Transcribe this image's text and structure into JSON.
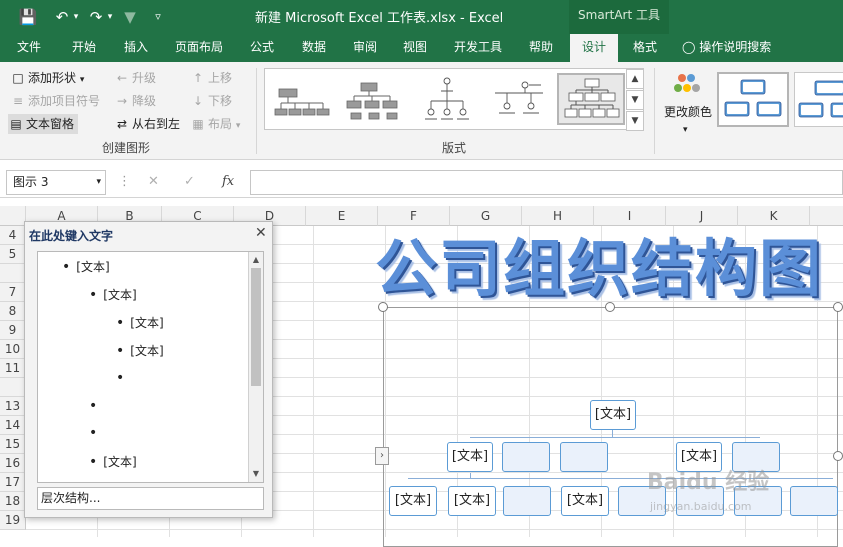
{
  "window": {
    "title": "新建 Microsoft Excel 工作表.xlsx  -  Excel",
    "context_title": "SmartArt 工具",
    "save_icon": "save-icon",
    "undo_icon": "undo-icon",
    "redo_icon": "redo-icon",
    "filter_icon": "filter-icon",
    "customize_icon": "customize-qat-icon"
  },
  "tabs": [
    "文件",
    "开始",
    "插入",
    "页面布局",
    "公式",
    "数据",
    "审阅",
    "视图",
    "开发工具",
    "帮助",
    "设计",
    "格式"
  ],
  "active_tab": "设计",
  "tell_me": "操作说明搜索",
  "ribbon": {
    "create_graphic": {
      "add_shape": "添加形状",
      "add_bullet": "添加项目符号",
      "text_pane": "文本窗格",
      "promote": "升级",
      "demote": "降级",
      "rtl": "从右到左",
      "move_up": "上移",
      "move_down": "下移",
      "layout": "布局",
      "label": "创建图形"
    },
    "layouts_label": "版式",
    "change_colors": "更改颜色"
  },
  "formula_bar": {
    "name_box": "图示 3",
    "cancel": "✕",
    "enter": "✓",
    "fx": "fx",
    "value": ""
  },
  "columns": [
    "A",
    "B",
    "C",
    "D",
    "E",
    "F",
    "G",
    "H",
    "I",
    "J",
    "K"
  ],
  "rows": [
    "4",
    "5",
    "7",
    "8",
    "9",
    "10",
    "11",
    "13",
    "14",
    "15",
    "16",
    "17",
    "18",
    "19"
  ],
  "sheet_title": "公司组织结构图",
  "text_pane": {
    "title": "在此处键入文字",
    "items": [
      "[文本]",
      "[文本]",
      "[文本]",
      "[文本]",
      "",
      "",
      "",
      "[文本]"
    ],
    "link": "层次结构..."
  },
  "org_chart": {
    "node_text": "[文本]"
  },
  "watermark": {
    "main": "Baidu 经验",
    "sub": "jingyan.baidu.com"
  },
  "colors": {
    "excel_green": "#217346",
    "smartart_blue": "#5b9bd5"
  }
}
